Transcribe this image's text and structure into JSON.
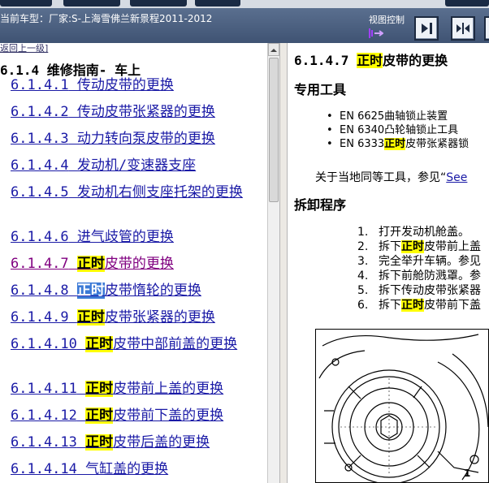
{
  "header": {
    "car_title": "当前车型：厂家:S-上海雪佛兰新景程2011-2012",
    "view_control_label": "视图控制",
    "view_icon": "view-toggle-icon",
    "buttons": [
      {
        "name": "show-right-panel-button",
        "icon": "arrow-right-icon"
      },
      {
        "name": "split-panels-button",
        "icon": "split-arrows-icon"
      }
    ]
  },
  "left": {
    "back_link": "返回上一级]",
    "heading": "6.1.4  维修指南- 车上",
    "items": [
      {
        "num": "6.1.4.1",
        "parts": [
          {
            "t": " 传动皮带的更换"
          }
        ]
      },
      {
        "num": "6.1.4.2",
        "parts": [
          {
            "t": " 传动皮带张紧器的更换"
          }
        ]
      },
      {
        "num": "6.1.4.3",
        "parts": [
          {
            "t": " 动力转向泵皮带的更换"
          }
        ]
      },
      {
        "num": "6.1.4.4",
        "parts": [
          {
            "t": " 发动机/变速器支座"
          }
        ]
      },
      {
        "num": "6.1.4.5",
        "parts": [
          {
            "t": " 发动机右侧支座托架的更换"
          }
        ]
      },
      {
        "num": "6.1.4.6",
        "parts": [
          {
            "t": " 进气歧管的更换"
          }
        ]
      },
      {
        "num": "6.1.4.7",
        "parts": [
          {
            "t": " "
          },
          {
            "t": "正时",
            "hl": true
          },
          {
            "t": "皮带的更换"
          }
        ],
        "visited": true
      },
      {
        "num": "6.1.4.8",
        "parts": [
          {
            "t": " "
          },
          {
            "t": "正时",
            "sel": true
          },
          {
            "t": "皮带惰轮的更换"
          }
        ]
      },
      {
        "num": "6.1.4.9",
        "parts": [
          {
            "t": " "
          },
          {
            "t": "正时",
            "hl": true
          },
          {
            "t": "皮带张紧器的更换"
          }
        ]
      },
      {
        "num": "6.1.4.10",
        "parts": [
          {
            "t": " "
          },
          {
            "t": "正时",
            "hl": true
          },
          {
            "t": "皮带中部前盖的更换"
          }
        ]
      },
      {
        "num": "6.1.4.11",
        "parts": [
          {
            "t": " "
          },
          {
            "t": "正时",
            "hl": true
          },
          {
            "t": "皮带前上盖的更换"
          }
        ]
      },
      {
        "num": "6.1.4.12",
        "parts": [
          {
            "t": " "
          },
          {
            "t": "正时",
            "hl": true
          },
          {
            "t": "皮带前下盖的更换"
          }
        ]
      },
      {
        "num": "6.1.4.13",
        "parts": [
          {
            "t": " "
          },
          {
            "t": "正时",
            "hl": true
          },
          {
            "t": "皮带后盖的更换"
          }
        ]
      },
      {
        "num": "6.1.4.14",
        "parts": [
          {
            "t": " 气缸盖的更换"
          }
        ]
      }
    ]
  },
  "right": {
    "title_num": "6.1.4.7 ",
    "title_hl": "正时",
    "title_rest": "皮带的更换",
    "tools_heading": "专用工具",
    "tools": [
      {
        "parts": [
          {
            "t": "EN 6625曲轴锁止装置"
          }
        ]
      },
      {
        "parts": [
          {
            "t": "EN 6340凸轮轴锁止工具"
          }
        ]
      },
      {
        "parts": [
          {
            "t": "EN 6333"
          },
          {
            "t": "正时",
            "hl": true
          },
          {
            "t": "皮带张紧器锁"
          }
        ]
      }
    ],
    "equiv_text": "关于当地同等工具，参见“",
    "equiv_link": "See",
    "removal_heading": "拆卸程序",
    "steps": [
      {
        "n": "1.",
        "parts": [
          {
            "t": "打开发动机舱盖。"
          }
        ]
      },
      {
        "n": "2.",
        "parts": [
          {
            "t": "拆下"
          },
          {
            "t": "正时",
            "hl": true
          },
          {
            "t": "皮带前上盖"
          }
        ]
      },
      {
        "n": "3.",
        "parts": [
          {
            "t": "完全举升车辆。参见"
          }
        ]
      },
      {
        "n": "4.",
        "parts": [
          {
            "t": "拆下前舱防溅罩。参"
          }
        ]
      },
      {
        "n": "5.",
        "parts": [
          {
            "t": "拆下传动皮带张紧器"
          }
        ]
      },
      {
        "n": "6.",
        "parts": [
          {
            "t": "拆下"
          },
          {
            "t": "正时",
            "hl": true
          },
          {
            "t": "皮带前下盖"
          }
        ]
      }
    ],
    "figure_label": "1"
  },
  "colors": {
    "header_bg": "#4a5f80",
    "link": "#1a1aa6",
    "visited": "#800080",
    "highlight": "#ffff00",
    "selection": "#3b79d6"
  }
}
